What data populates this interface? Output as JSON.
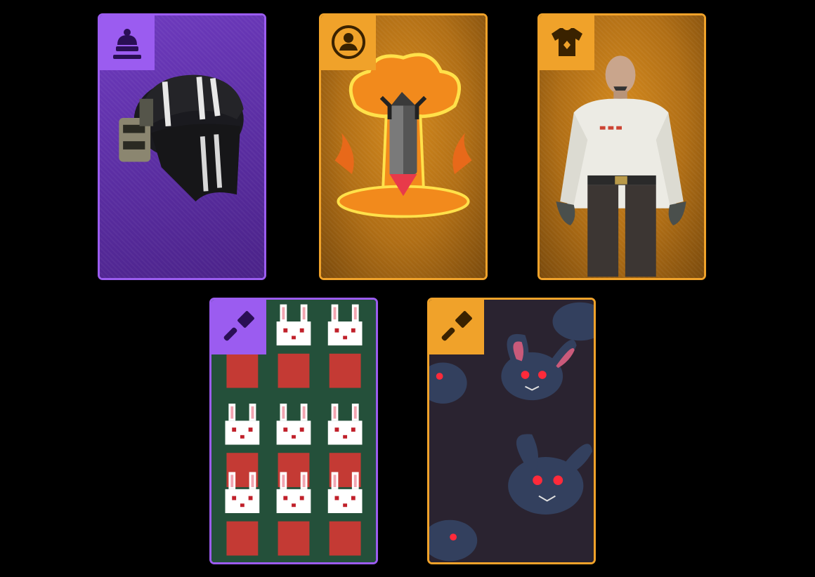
{
  "colors": {
    "background": "#000000",
    "rarity_epic": "#9b5cf0",
    "rarity_legendary": "#f0a22a"
  },
  "cards": [
    {
      "id": "card-headgear",
      "rarity": "epic",
      "category_icon": "headgear-icon",
      "art": "striped-beanie-with-face-mask"
    },
    {
      "id": "card-avatar",
      "rarity": "legendary",
      "category_icon": "avatar-icon",
      "art": "nuclear-bomb-explosion"
    },
    {
      "id": "card-outfit",
      "rarity": "legendary",
      "category_icon": "outfit-icon",
      "art": "officer-white-uniform-character"
    },
    {
      "id": "card-skin-pixel-rabbits",
      "rarity": "epic",
      "category_icon": "paintbrush-icon",
      "art": "pixel-rabbit-pattern"
    },
    {
      "id": "card-skin-dark-rabbits",
      "rarity": "legendary",
      "category_icon": "paintbrush-icon",
      "art": "dark-rabbits-pattern"
    }
  ]
}
